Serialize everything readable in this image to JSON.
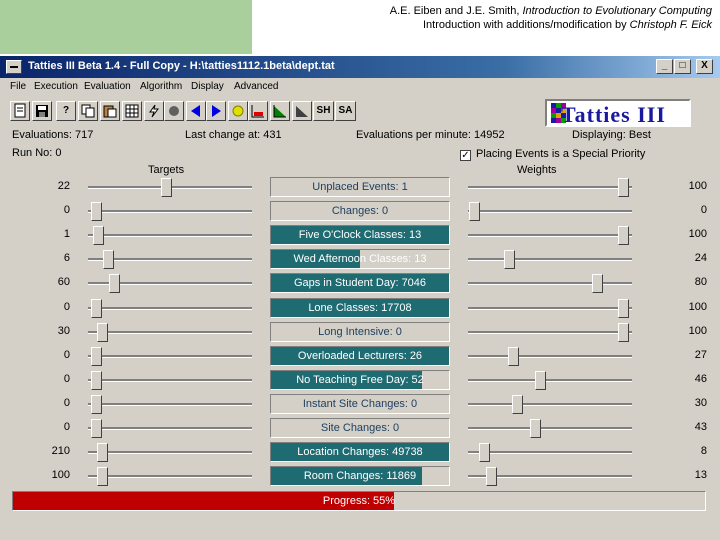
{
  "slide_header": {
    "authors": "A.E. Eiben and J.E. Smith, ",
    "book_title": "Introduction to Evolutionary Computing",
    "line2_prefix": "Introduction with additions/modification by ",
    "line2_author": "Christoph F. Eick"
  },
  "window": {
    "title": "Tatties III Beta 1.4 - Full Copy - H:\\tatties1112.1beta\\dept.tat",
    "minimize": "_",
    "maximize": "□",
    "close": "X"
  },
  "menu": [
    "File",
    "Execution",
    "Evaluation",
    "Algorithm",
    "Display",
    "Advanced"
  ],
  "toolbar": {
    "help": "?",
    "sh": "SH",
    "sa": "SA"
  },
  "logo": {
    "text": "Tatties III"
  },
  "stats": {
    "evaluations": "Evaluations: 717",
    "last_change": "Last change at: 431",
    "per_minute": "Evaluations per minute: 14952",
    "displaying": "Displaying: Best",
    "run_no": "Run No: 0",
    "placing_events_label": "Placing Events is a Special Priority",
    "placing_events_checked": true
  },
  "columns": {
    "targets": "Targets",
    "weights": "Weights"
  },
  "rows": [
    {
      "target": "22",
      "label": "Unplaced Events: 1",
      "fill": 0,
      "weight": "100",
      "t_pos": 0.48,
      "w_pos": 0.97
    },
    {
      "target": "0",
      "label": "Changes: 0",
      "fill": 0,
      "weight": "0",
      "t_pos": 0.02,
      "w_pos": 0.02
    },
    {
      "target": "1",
      "label": "Five O'Clock Classes: 13",
      "fill": 1.0,
      "weight": "100",
      "t_pos": 0.03,
      "w_pos": 0.97
    },
    {
      "target": "6",
      "label": "Wed Afternoon Classes: 13",
      "fill": 0.5,
      "weight": "24",
      "t_pos": 0.1,
      "w_pos": 0.24
    },
    {
      "target": "60",
      "label": "Gaps in Student Day: 7046",
      "fill": 1.0,
      "weight": "80",
      "t_pos": 0.14,
      "w_pos": 0.8
    },
    {
      "target": "0",
      "label": "Lone Classes: 17708",
      "fill": 1.0,
      "weight": "100",
      "t_pos": 0.02,
      "w_pos": 0.97
    },
    {
      "target": "30",
      "label": "Long Intensive: 0",
      "fill": 0,
      "weight": "100",
      "t_pos": 0.06,
      "w_pos": 0.97
    },
    {
      "target": "0",
      "label": "Overloaded Lecturers: 26",
      "fill": 1.0,
      "weight": "27",
      "t_pos": 0.02,
      "w_pos": 0.27
    },
    {
      "target": "0",
      "label": "No Teaching Free Day: 52",
      "fill": 0.85,
      "weight": "46",
      "t_pos": 0.02,
      "w_pos": 0.44
    },
    {
      "target": "0",
      "label": "Instant Site Changes: 0",
      "fill": 0,
      "weight": "30",
      "t_pos": 0.02,
      "w_pos": 0.29
    },
    {
      "target": "0",
      "label": "Site Changes: 0",
      "fill": 0,
      "weight": "43",
      "t_pos": 0.02,
      "w_pos": 0.41
    },
    {
      "target": "210",
      "label": "Location Changes: 49738",
      "fill": 1.0,
      "weight": "8",
      "t_pos": 0.06,
      "w_pos": 0.08
    },
    {
      "target": "100",
      "label": "Room Changes: 11869",
      "fill": 0.85,
      "weight": "13",
      "t_pos": 0.06,
      "w_pos": 0.13
    }
  ],
  "progress": {
    "label": "Progress: 55%",
    "value": 0.55
  },
  "colors": {
    "bar_fill": "#1f6b72",
    "progress_fill": "#c00000",
    "title_bar": "#0a246a",
    "panel": "#d4d0c8",
    "green_block": "#a9cf9c"
  }
}
